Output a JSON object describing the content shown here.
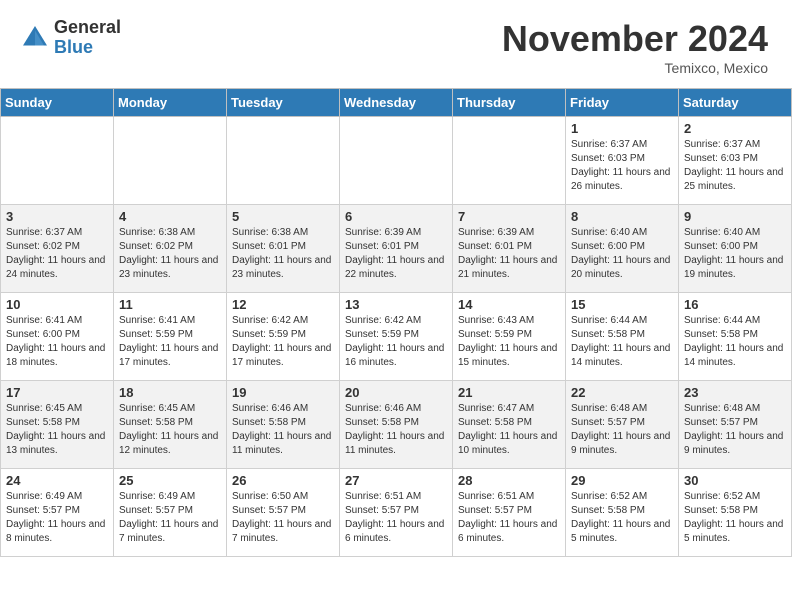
{
  "header": {
    "logo_general": "General",
    "logo_blue": "Blue",
    "month_title": "November 2024",
    "location": "Temixco, Mexico"
  },
  "weekdays": [
    "Sunday",
    "Monday",
    "Tuesday",
    "Wednesday",
    "Thursday",
    "Friday",
    "Saturday"
  ],
  "weeks": [
    [
      {
        "day": "",
        "info": ""
      },
      {
        "day": "",
        "info": ""
      },
      {
        "day": "",
        "info": ""
      },
      {
        "day": "",
        "info": ""
      },
      {
        "day": "",
        "info": ""
      },
      {
        "day": "1",
        "info": "Sunrise: 6:37 AM\nSunset: 6:03 PM\nDaylight: 11 hours and 26 minutes."
      },
      {
        "day": "2",
        "info": "Sunrise: 6:37 AM\nSunset: 6:03 PM\nDaylight: 11 hours and 25 minutes."
      }
    ],
    [
      {
        "day": "3",
        "info": "Sunrise: 6:37 AM\nSunset: 6:02 PM\nDaylight: 11 hours and 24 minutes."
      },
      {
        "day": "4",
        "info": "Sunrise: 6:38 AM\nSunset: 6:02 PM\nDaylight: 11 hours and 23 minutes."
      },
      {
        "day": "5",
        "info": "Sunrise: 6:38 AM\nSunset: 6:01 PM\nDaylight: 11 hours and 23 minutes."
      },
      {
        "day": "6",
        "info": "Sunrise: 6:39 AM\nSunset: 6:01 PM\nDaylight: 11 hours and 22 minutes."
      },
      {
        "day": "7",
        "info": "Sunrise: 6:39 AM\nSunset: 6:01 PM\nDaylight: 11 hours and 21 minutes."
      },
      {
        "day": "8",
        "info": "Sunrise: 6:40 AM\nSunset: 6:00 PM\nDaylight: 11 hours and 20 minutes."
      },
      {
        "day": "9",
        "info": "Sunrise: 6:40 AM\nSunset: 6:00 PM\nDaylight: 11 hours and 19 minutes."
      }
    ],
    [
      {
        "day": "10",
        "info": "Sunrise: 6:41 AM\nSunset: 6:00 PM\nDaylight: 11 hours and 18 minutes."
      },
      {
        "day": "11",
        "info": "Sunrise: 6:41 AM\nSunset: 5:59 PM\nDaylight: 11 hours and 17 minutes."
      },
      {
        "day": "12",
        "info": "Sunrise: 6:42 AM\nSunset: 5:59 PM\nDaylight: 11 hours and 17 minutes."
      },
      {
        "day": "13",
        "info": "Sunrise: 6:42 AM\nSunset: 5:59 PM\nDaylight: 11 hours and 16 minutes."
      },
      {
        "day": "14",
        "info": "Sunrise: 6:43 AM\nSunset: 5:59 PM\nDaylight: 11 hours and 15 minutes."
      },
      {
        "day": "15",
        "info": "Sunrise: 6:44 AM\nSunset: 5:58 PM\nDaylight: 11 hours and 14 minutes."
      },
      {
        "day": "16",
        "info": "Sunrise: 6:44 AM\nSunset: 5:58 PM\nDaylight: 11 hours and 14 minutes."
      }
    ],
    [
      {
        "day": "17",
        "info": "Sunrise: 6:45 AM\nSunset: 5:58 PM\nDaylight: 11 hours and 13 minutes."
      },
      {
        "day": "18",
        "info": "Sunrise: 6:45 AM\nSunset: 5:58 PM\nDaylight: 11 hours and 12 minutes."
      },
      {
        "day": "19",
        "info": "Sunrise: 6:46 AM\nSunset: 5:58 PM\nDaylight: 11 hours and 11 minutes."
      },
      {
        "day": "20",
        "info": "Sunrise: 6:46 AM\nSunset: 5:58 PM\nDaylight: 11 hours and 11 minutes."
      },
      {
        "day": "21",
        "info": "Sunrise: 6:47 AM\nSunset: 5:58 PM\nDaylight: 11 hours and 10 minutes."
      },
      {
        "day": "22",
        "info": "Sunrise: 6:48 AM\nSunset: 5:57 PM\nDaylight: 11 hours and 9 minutes."
      },
      {
        "day": "23",
        "info": "Sunrise: 6:48 AM\nSunset: 5:57 PM\nDaylight: 11 hours and 9 minutes."
      }
    ],
    [
      {
        "day": "24",
        "info": "Sunrise: 6:49 AM\nSunset: 5:57 PM\nDaylight: 11 hours and 8 minutes."
      },
      {
        "day": "25",
        "info": "Sunrise: 6:49 AM\nSunset: 5:57 PM\nDaylight: 11 hours and 7 minutes."
      },
      {
        "day": "26",
        "info": "Sunrise: 6:50 AM\nSunset: 5:57 PM\nDaylight: 11 hours and 7 minutes."
      },
      {
        "day": "27",
        "info": "Sunrise: 6:51 AM\nSunset: 5:57 PM\nDaylight: 11 hours and 6 minutes."
      },
      {
        "day": "28",
        "info": "Sunrise: 6:51 AM\nSunset: 5:57 PM\nDaylight: 11 hours and 6 minutes."
      },
      {
        "day": "29",
        "info": "Sunrise: 6:52 AM\nSunset: 5:58 PM\nDaylight: 11 hours and 5 minutes."
      },
      {
        "day": "30",
        "info": "Sunrise: 6:52 AM\nSunset: 5:58 PM\nDaylight: 11 hours and 5 minutes."
      }
    ]
  ]
}
